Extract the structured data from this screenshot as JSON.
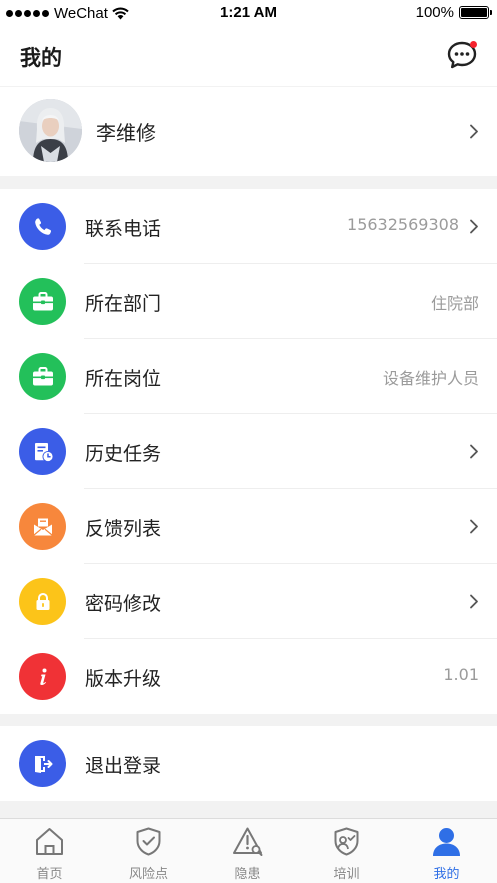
{
  "status_bar": {
    "carrier": "WeChat",
    "time": "1:21 AM",
    "battery": "100%"
  },
  "header": {
    "title": "我的",
    "message_icon": "chat-bubble-icon"
  },
  "profile": {
    "name": "李维修"
  },
  "menu": [
    {
      "label": "联系电话",
      "value": "15632569308",
      "icon": "phone-icon",
      "color": "#3b5de7",
      "chevron": true
    },
    {
      "label": "所在部门",
      "value": "住院部",
      "icon": "briefcase-icon",
      "color": "#23c05a",
      "chevron": false
    },
    {
      "label": "所在岗位",
      "value": "设备维护人员",
      "icon": "briefcase-icon",
      "color": "#23c05a",
      "chevron": false
    },
    {
      "label": "历史任务",
      "value": "",
      "icon": "history-task-icon",
      "color": "#3b5de7",
      "chevron": true
    },
    {
      "label": "反馈列表",
      "value": "",
      "icon": "envelope-icon",
      "color": "#f7873c",
      "chevron": true
    },
    {
      "label": "密码修改",
      "value": "",
      "icon": "lock-icon",
      "color": "#fcc419",
      "chevron": true
    },
    {
      "label": "版本升级",
      "value": "1.01",
      "icon": "info-icon",
      "color": "#f03236",
      "chevron": false
    }
  ],
  "logout": {
    "label": "退出登录",
    "icon": "logout-icon",
    "color": "#3b5de7"
  },
  "tabs": [
    {
      "label": "首页",
      "icon": "home-icon"
    },
    {
      "label": "风险点",
      "icon": "shield-check-icon"
    },
    {
      "label": "隐患",
      "icon": "warning-search-icon"
    },
    {
      "label": "培训",
      "icon": "training-icon"
    },
    {
      "label": "我的",
      "icon": "person-icon",
      "active": true
    }
  ],
  "colors": {
    "accent": "#2f6fe6",
    "tab_inactive": "#888888"
  }
}
